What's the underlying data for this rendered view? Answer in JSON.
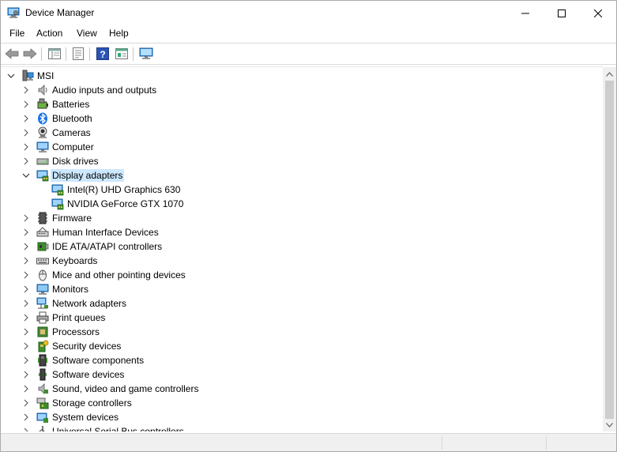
{
  "window": {
    "title": "Device Manager",
    "controls": {
      "minimize": "minimize",
      "maximize": "maximize",
      "close": "close"
    }
  },
  "menu": [
    {
      "label": "File"
    },
    {
      "label": "Action"
    },
    {
      "label": "View"
    },
    {
      "label": "Help"
    }
  ],
  "toolbar": [
    {
      "name": "back-button",
      "icon": "arrow-left-icon"
    },
    {
      "name": "forward-button",
      "icon": "arrow-right-icon"
    },
    {
      "name": "show-hide-console-tree-button",
      "icon": "console-tree-icon"
    },
    {
      "name": "properties-button",
      "icon": "properties-icon"
    },
    {
      "name": "help-button",
      "icon": "help-icon"
    },
    {
      "name": "update-driver-button",
      "icon": "update-driver-icon"
    },
    {
      "name": "scan-hardware-button",
      "icon": "monitor-scan-icon"
    }
  ],
  "tree": {
    "root": {
      "label": "MSI",
      "expanded": true,
      "icon": "computer-root-icon"
    },
    "items": [
      {
        "label": "Audio inputs and outputs",
        "icon": "speaker-icon",
        "expanded": false
      },
      {
        "label": "Batteries",
        "icon": "battery-icon",
        "expanded": false
      },
      {
        "label": "Bluetooth",
        "icon": "bluetooth-icon",
        "expanded": false
      },
      {
        "label": "Cameras",
        "icon": "camera-icon",
        "expanded": false
      },
      {
        "label": "Computer",
        "icon": "computer-icon",
        "expanded": false
      },
      {
        "label": "Disk drives",
        "icon": "disk-drive-icon",
        "expanded": false
      },
      {
        "label": "Display adapters",
        "icon": "display-adapter-icon",
        "expanded": true,
        "selected": true,
        "children": [
          {
            "label": "Intel(R) UHD Graphics 630",
            "icon": "display-adapter-icon"
          },
          {
            "label": "NVIDIA GeForce GTX 1070",
            "icon": "display-adapter-icon"
          }
        ]
      },
      {
        "label": "Firmware",
        "icon": "firmware-icon",
        "expanded": false
      },
      {
        "label": "Human Interface Devices",
        "icon": "hid-icon",
        "expanded": false
      },
      {
        "label": "IDE ATA/ATAPI controllers",
        "icon": "ide-controller-icon",
        "expanded": false
      },
      {
        "label": "Keyboards",
        "icon": "keyboard-icon",
        "expanded": false
      },
      {
        "label": "Mice and other pointing devices",
        "icon": "mouse-icon",
        "expanded": false
      },
      {
        "label": "Monitors",
        "icon": "monitor-icon",
        "expanded": false
      },
      {
        "label": "Network adapters",
        "icon": "network-adapter-icon",
        "expanded": false
      },
      {
        "label": "Print queues",
        "icon": "printer-icon",
        "expanded": false
      },
      {
        "label": "Processors",
        "icon": "processor-icon",
        "expanded": false
      },
      {
        "label": "Security devices",
        "icon": "security-device-icon",
        "expanded": false
      },
      {
        "label": "Software components",
        "icon": "software-component-icon",
        "expanded": false
      },
      {
        "label": "Software devices",
        "icon": "software-device-icon",
        "expanded": false
      },
      {
        "label": "Sound, video and game controllers",
        "icon": "sound-controller-icon",
        "expanded": false
      },
      {
        "label": "Storage controllers",
        "icon": "storage-controller-icon",
        "expanded": false
      },
      {
        "label": "System devices",
        "icon": "system-device-icon",
        "expanded": false
      },
      {
        "label": "Universal Serial Bus controllers",
        "icon": "usb-icon",
        "expanded": false
      }
    ]
  },
  "colors": {
    "selection": "#cce8ff",
    "accent": "#0078d7"
  }
}
